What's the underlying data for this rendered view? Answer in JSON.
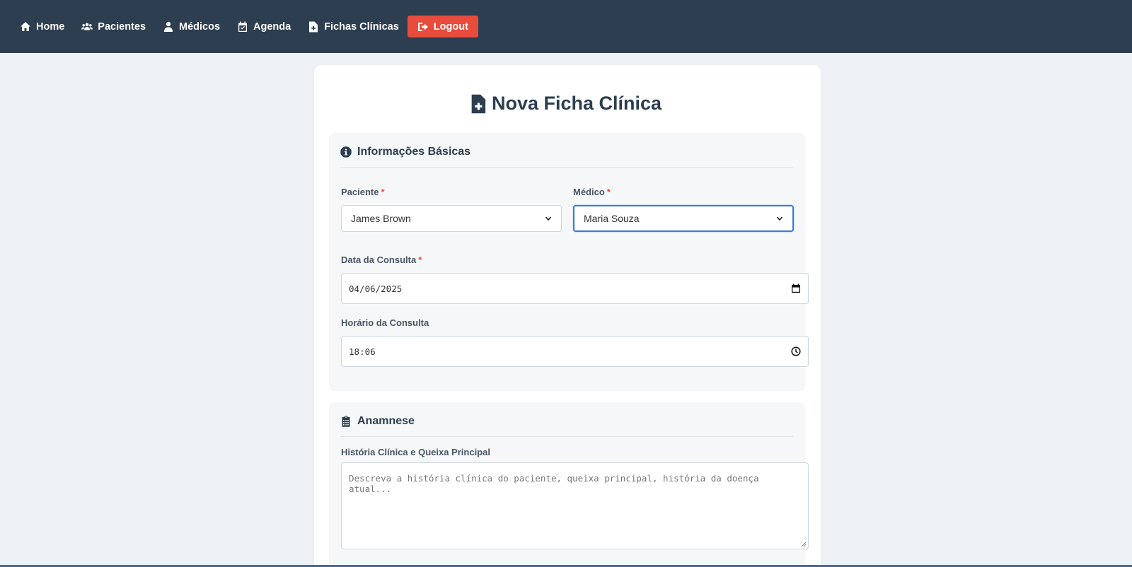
{
  "nav": {
    "items": [
      {
        "label": "Home",
        "icon": "home-icon"
      },
      {
        "label": "Pacientes",
        "icon": "users-icon"
      },
      {
        "label": "Médicos",
        "icon": "doctor-icon"
      },
      {
        "label": "Agenda",
        "icon": "calendar-check-icon"
      },
      {
        "label": "Fichas Clínicas",
        "icon": "file-medical-icon"
      }
    ],
    "logout_label": "Logout"
  },
  "page": {
    "title": "Nova Ficha Clínica"
  },
  "basic_info": {
    "header": "Informações Básicas",
    "paciente_label": "Paciente",
    "paciente_value": "James Brown",
    "medico_label": "Médico",
    "medico_value": "Maria Souza",
    "data_label": "Data da Consulta",
    "data_value": "04/06/2025",
    "horario_label": "Horário da Consulta",
    "horario_value": "18:06",
    "required_mark": "*"
  },
  "anamnese": {
    "header": "Anamnese",
    "historia_label": "História Clínica e Queixa Principal",
    "historia_placeholder": "Descreva a história clínica do paciente, queixa principal, história da doença atual..."
  },
  "colors": {
    "navbar": "#2d3e50",
    "logout": "#e74c3c",
    "focus": "#3a7bd5",
    "required": "#e74c3c"
  }
}
